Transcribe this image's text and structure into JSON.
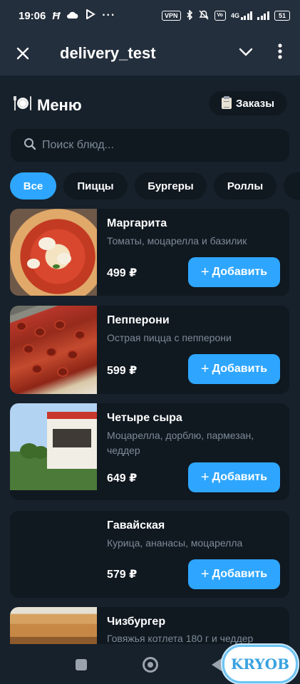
{
  "status_bar": {
    "time": "19:06",
    "notification_icons": [
      "h-icon",
      "cloud-icon",
      "play-icon",
      "more-icon"
    ],
    "vpn_label": "VPN",
    "network_label": "4G",
    "battery": "51"
  },
  "header": {
    "title": "delivery_test"
  },
  "menu": {
    "title": "Меню",
    "orders_label": "Заказы"
  },
  "search": {
    "placeholder": "Поиск блюд..."
  },
  "categories": [
    {
      "label": "Все",
      "active": true
    },
    {
      "label": "Пиццы",
      "active": false
    },
    {
      "label": "Бургеры",
      "active": false
    },
    {
      "label": "Роллы",
      "active": false
    }
  ],
  "add_label": "Добавить",
  "products": [
    {
      "name": "Маргарита",
      "description": "Томаты, моцарелла и базилик",
      "price": "499 ₽"
    },
    {
      "name": "Пепперони",
      "description": "Острая пицца с пепперони",
      "price": "599 ₽"
    },
    {
      "name": "Четыре сыра",
      "description": "Моцарелла, дорблю, пармезан, чеддер",
      "price": "649 ₽"
    },
    {
      "name": "Гавайская",
      "description": "Курица, ананасы, моцарелла",
      "price": "579 ₽"
    },
    {
      "name": "Чизбургер",
      "description": "Говяжья котлета 180 г и чеддер",
      "price": ""
    }
  ],
  "watermark": "KRYOB",
  "colors": {
    "accent": "#2ea6ff",
    "background": "#17212b",
    "header": "#242f3d",
    "card": "#101820",
    "muted_text": "#7d8b99"
  }
}
